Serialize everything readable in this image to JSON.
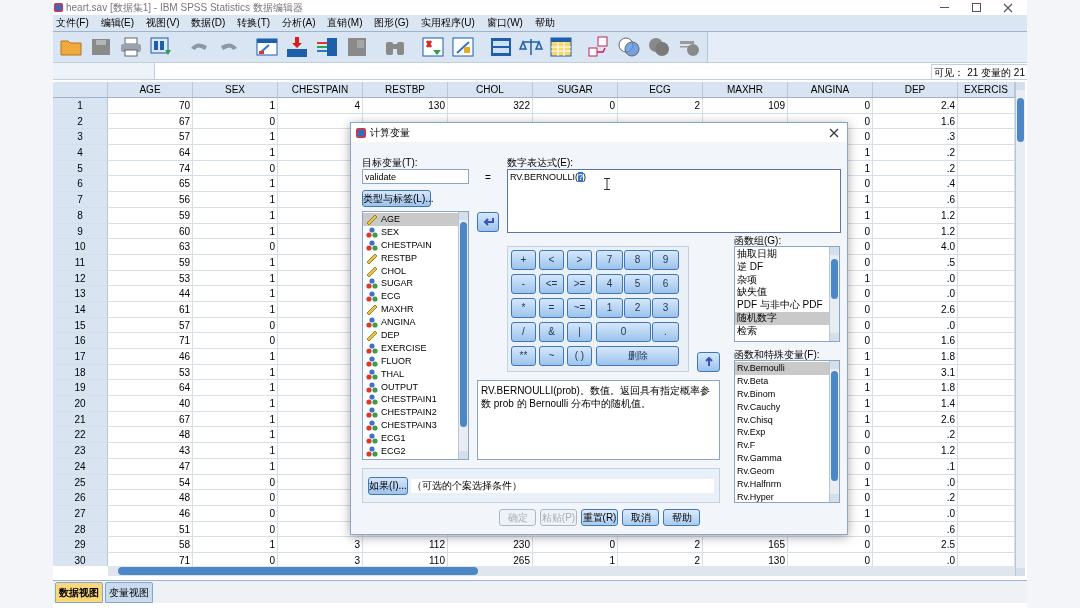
{
  "window": {
    "title": "heart.sav [数据集1] - IBM SPSS Statistics 数据编辑器"
  },
  "menu": [
    "文件(F)",
    "编辑(E)",
    "视图(V)",
    "数据(D)",
    "转换(T)",
    "分析(A)",
    "直销(M)",
    "图形(G)",
    "实用程序(U)",
    "窗口(W)",
    "帮助"
  ],
  "status": "可见： 21 变量的 21",
  "grid": {
    "columns": [
      "AGE",
      "SEX",
      "CHESTPAIN",
      "RESTBP",
      "CHOL",
      "SUGAR",
      "ECG",
      "MAXHR",
      "ANGINA",
      "DEP",
      "EXERCIS"
    ],
    "rows": [
      {
        "label": "1",
        "cells": [
          "70",
          "1",
          "4",
          "130",
          "322",
          "0",
          "2",
          "109",
          "0",
          "2.4"
        ]
      },
      {
        "label": "2",
        "cells": [
          "67",
          "0",
          null,
          null,
          null,
          null,
          null,
          null,
          "0",
          "1.6"
        ]
      },
      {
        "label": "3",
        "cells": [
          "57",
          "1",
          null,
          null,
          null,
          null,
          null,
          null,
          "0",
          ".3"
        ]
      },
      {
        "label": "4",
        "cells": [
          "64",
          "1",
          null,
          null,
          null,
          null,
          null,
          null,
          "1",
          ".2"
        ]
      },
      {
        "label": "5",
        "cells": [
          "74",
          "0",
          null,
          null,
          null,
          null,
          null,
          null,
          "1",
          ".2"
        ]
      },
      {
        "label": "6",
        "cells": [
          "65",
          "1",
          null,
          null,
          null,
          null,
          null,
          null,
          "0",
          ".4"
        ]
      },
      {
        "label": "7",
        "cells": [
          "56",
          "1",
          null,
          null,
          null,
          null,
          null,
          null,
          "1",
          ".6"
        ]
      },
      {
        "label": "8",
        "cells": [
          "59",
          "1",
          null,
          null,
          null,
          null,
          null,
          null,
          "1",
          "1.2"
        ]
      },
      {
        "label": "9",
        "cells": [
          "60",
          "1",
          null,
          null,
          null,
          null,
          null,
          null,
          "0",
          "1.2"
        ]
      },
      {
        "label": "10",
        "cells": [
          "63",
          "0",
          null,
          null,
          null,
          null,
          null,
          null,
          "0",
          "4.0"
        ]
      },
      {
        "label": "11",
        "cells": [
          "59",
          "1",
          null,
          null,
          null,
          null,
          null,
          null,
          "0",
          ".5"
        ]
      },
      {
        "label": "12",
        "cells": [
          "53",
          "1",
          null,
          null,
          null,
          null,
          null,
          null,
          "1",
          ".0"
        ]
      },
      {
        "label": "13",
        "cells": [
          "44",
          "1",
          null,
          null,
          null,
          null,
          null,
          null,
          "0",
          ".0"
        ]
      },
      {
        "label": "14",
        "cells": [
          "61",
          "1",
          null,
          null,
          null,
          null,
          null,
          null,
          "0",
          "2.6"
        ]
      },
      {
        "label": "15",
        "cells": [
          "57",
          "0",
          null,
          null,
          null,
          null,
          null,
          null,
          "0",
          ".0"
        ]
      },
      {
        "label": "16",
        "cells": [
          "71",
          "0",
          null,
          null,
          null,
          null,
          null,
          null,
          "0",
          "1.6"
        ]
      },
      {
        "label": "17",
        "cells": [
          "46",
          "1",
          null,
          null,
          null,
          null,
          null,
          null,
          "1",
          "1.8"
        ]
      },
      {
        "label": "18",
        "cells": [
          "53",
          "1",
          null,
          null,
          null,
          null,
          null,
          null,
          "1",
          "3.1"
        ]
      },
      {
        "label": "19",
        "cells": [
          "64",
          "1",
          null,
          null,
          null,
          null,
          null,
          null,
          "1",
          "1.8"
        ]
      },
      {
        "label": "20",
        "cells": [
          "40",
          "1",
          null,
          null,
          null,
          null,
          null,
          null,
          "1",
          "1.4"
        ]
      },
      {
        "label": "21",
        "cells": [
          "67",
          "1",
          null,
          null,
          null,
          null,
          null,
          null,
          "1",
          "2.6"
        ]
      },
      {
        "label": "22",
        "cells": [
          "48",
          "1",
          null,
          null,
          null,
          null,
          null,
          null,
          "0",
          ".2"
        ]
      },
      {
        "label": "23",
        "cells": [
          "43",
          "1",
          null,
          null,
          null,
          null,
          null,
          null,
          "0",
          "1.2"
        ]
      },
      {
        "label": "24",
        "cells": [
          "47",
          "1",
          null,
          null,
          null,
          null,
          null,
          null,
          "0",
          ".1"
        ]
      },
      {
        "label": "25",
        "cells": [
          "54",
          "0",
          null,
          null,
          null,
          null,
          null,
          null,
          "1",
          ".0"
        ]
      },
      {
        "label": "26",
        "cells": [
          "48",
          "0",
          null,
          null,
          null,
          null,
          null,
          null,
          "0",
          ".2"
        ]
      },
      {
        "label": "27",
        "cells": [
          "46",
          "0",
          null,
          null,
          null,
          null,
          null,
          null,
          "1",
          ".0"
        ]
      },
      {
        "label": "28",
        "cells": [
          "51",
          "0",
          null,
          null,
          null,
          null,
          null,
          null,
          "0",
          ".6"
        ]
      },
      {
        "label": "29",
        "cells": [
          "58",
          "1",
          "3",
          "112",
          "230",
          "0",
          "2",
          "165",
          "0",
          "2.5"
        ]
      },
      {
        "label": "30",
        "cells": [
          "71",
          "0",
          "3",
          "110",
          "265",
          "1",
          "2",
          "130",
          "0",
          ".0"
        ]
      }
    ]
  },
  "tabs": [
    {
      "label": "数据视图",
      "selected": true
    },
    {
      "label": "变量视图",
      "selected": false
    }
  ],
  "dialog": {
    "title": "计算变量",
    "target_label": "目标变量(T):",
    "target_value": "validate",
    "equals": "=",
    "expression_label": "数字表达式(E):",
    "expression": {
      "before": "RV.BERNOULLI(",
      "selected": "?",
      "after": ")"
    },
    "type_button": "类型与标签(L)...",
    "variables": [
      {
        "name": "AGE",
        "kind": "scale",
        "selected": true
      },
      {
        "name": "SEX",
        "kind": "nominal",
        "selected": false
      },
      {
        "name": "CHESTPAIN",
        "kind": "nominal",
        "selected": false
      },
      {
        "name": "RESTBP",
        "kind": "scale",
        "selected": false
      },
      {
        "name": "CHOL",
        "kind": "scale",
        "selected": false
      },
      {
        "name": "SUGAR",
        "kind": "nominal",
        "selected": false
      },
      {
        "name": "ECG",
        "kind": "nominal",
        "selected": false
      },
      {
        "name": "MAXHR",
        "kind": "scale",
        "selected": false
      },
      {
        "name": "ANGINA",
        "kind": "nominal",
        "selected": false
      },
      {
        "name": "DEP",
        "kind": "scale",
        "selected": false
      },
      {
        "name": "EXERCISE",
        "kind": "nominal",
        "selected": false
      },
      {
        "name": "FLUOR",
        "kind": "nominal",
        "selected": false
      },
      {
        "name": "THAL",
        "kind": "nominal",
        "selected": false
      },
      {
        "name": "OUTPUT",
        "kind": "nominal",
        "selected": false
      },
      {
        "name": "CHESTPAIN1",
        "kind": "nominal",
        "selected": false
      },
      {
        "name": "CHESTPAIN2",
        "kind": "nominal",
        "selected": false
      },
      {
        "name": "CHESTPAIN3",
        "kind": "nominal",
        "selected": false
      },
      {
        "name": "ECG1",
        "kind": "nominal",
        "selected": false
      },
      {
        "name": "ECG2",
        "kind": "nominal",
        "selected": false
      }
    ],
    "operators": [
      "+",
      "<",
      ">",
      "-",
      "<=",
      ">=",
      "*",
      "=",
      "~=",
      "/",
      "&",
      "|",
      "**",
      "~",
      "( )"
    ],
    "digits": [
      {
        "label": "7",
        "kind": "single"
      },
      {
        "label": "8",
        "kind": "single"
      },
      {
        "label": "9",
        "kind": "single"
      },
      {
        "label": "4",
        "kind": "single"
      },
      {
        "label": "5",
        "kind": "single"
      },
      {
        "label": "6",
        "kind": "single"
      },
      {
        "label": "1",
        "kind": "single"
      },
      {
        "label": "2",
        "kind": "single"
      },
      {
        "label": "3",
        "kind": "single"
      },
      {
        "label": "0",
        "kind": "double"
      },
      {
        "label": ".",
        "kind": "single"
      },
      {
        "label": "删除",
        "kind": "triple"
      }
    ],
    "description": "RV.BERNOULLI(prob)。数值。返回具有指定概率参数 prob 的 Bernoulli 分布中的随机值。",
    "if_button": "如果(I)...",
    "if_text": "（可选的个案选择条件）",
    "group_label": "函数组(G):",
    "groups": [
      {
        "label": "抽取日期",
        "selected": false
      },
      {
        "label": "逆 DF",
        "selected": false
      },
      {
        "label": "杂项",
        "selected": false
      },
      {
        "label": "缺失值",
        "selected": false
      },
      {
        "label": "PDF 与非中心 PDF",
        "selected": false
      },
      {
        "label": "随机数字",
        "selected": true
      },
      {
        "label": "检索",
        "selected": false
      }
    ],
    "functions_label": "函数和特殊变量(F):",
    "functions": [
      {
        "label": "Rv.Bernoulli",
        "selected": true
      },
      {
        "label": "Rv.Beta",
        "selected": false
      },
      {
        "label": "Rv.Binom",
        "selected": false
      },
      {
        "label": "Rv.Cauchy",
        "selected": false
      },
      {
        "label": "Rv.Chisq",
        "selected": false
      },
      {
        "label": "Rv.Exp",
        "selected": false
      },
      {
        "label": "Rv.F",
        "selected": false
      },
      {
        "label": "Rv.Gamma",
        "selected": false
      },
      {
        "label": "Rv.Geom",
        "selected": false
      },
      {
        "label": "Rv.Halfnrm",
        "selected": false
      },
      {
        "label": "Rv.Hyper",
        "selected": false
      }
    ],
    "buttons": [
      {
        "label": "确定",
        "disabled": true
      },
      {
        "label": "粘贴(P)",
        "disabled": true
      },
      {
        "label": "重置(R)",
        "disabled": false
      },
      {
        "label": "取消",
        "disabled": false
      },
      {
        "label": "帮助",
        "disabled": false
      }
    ]
  }
}
